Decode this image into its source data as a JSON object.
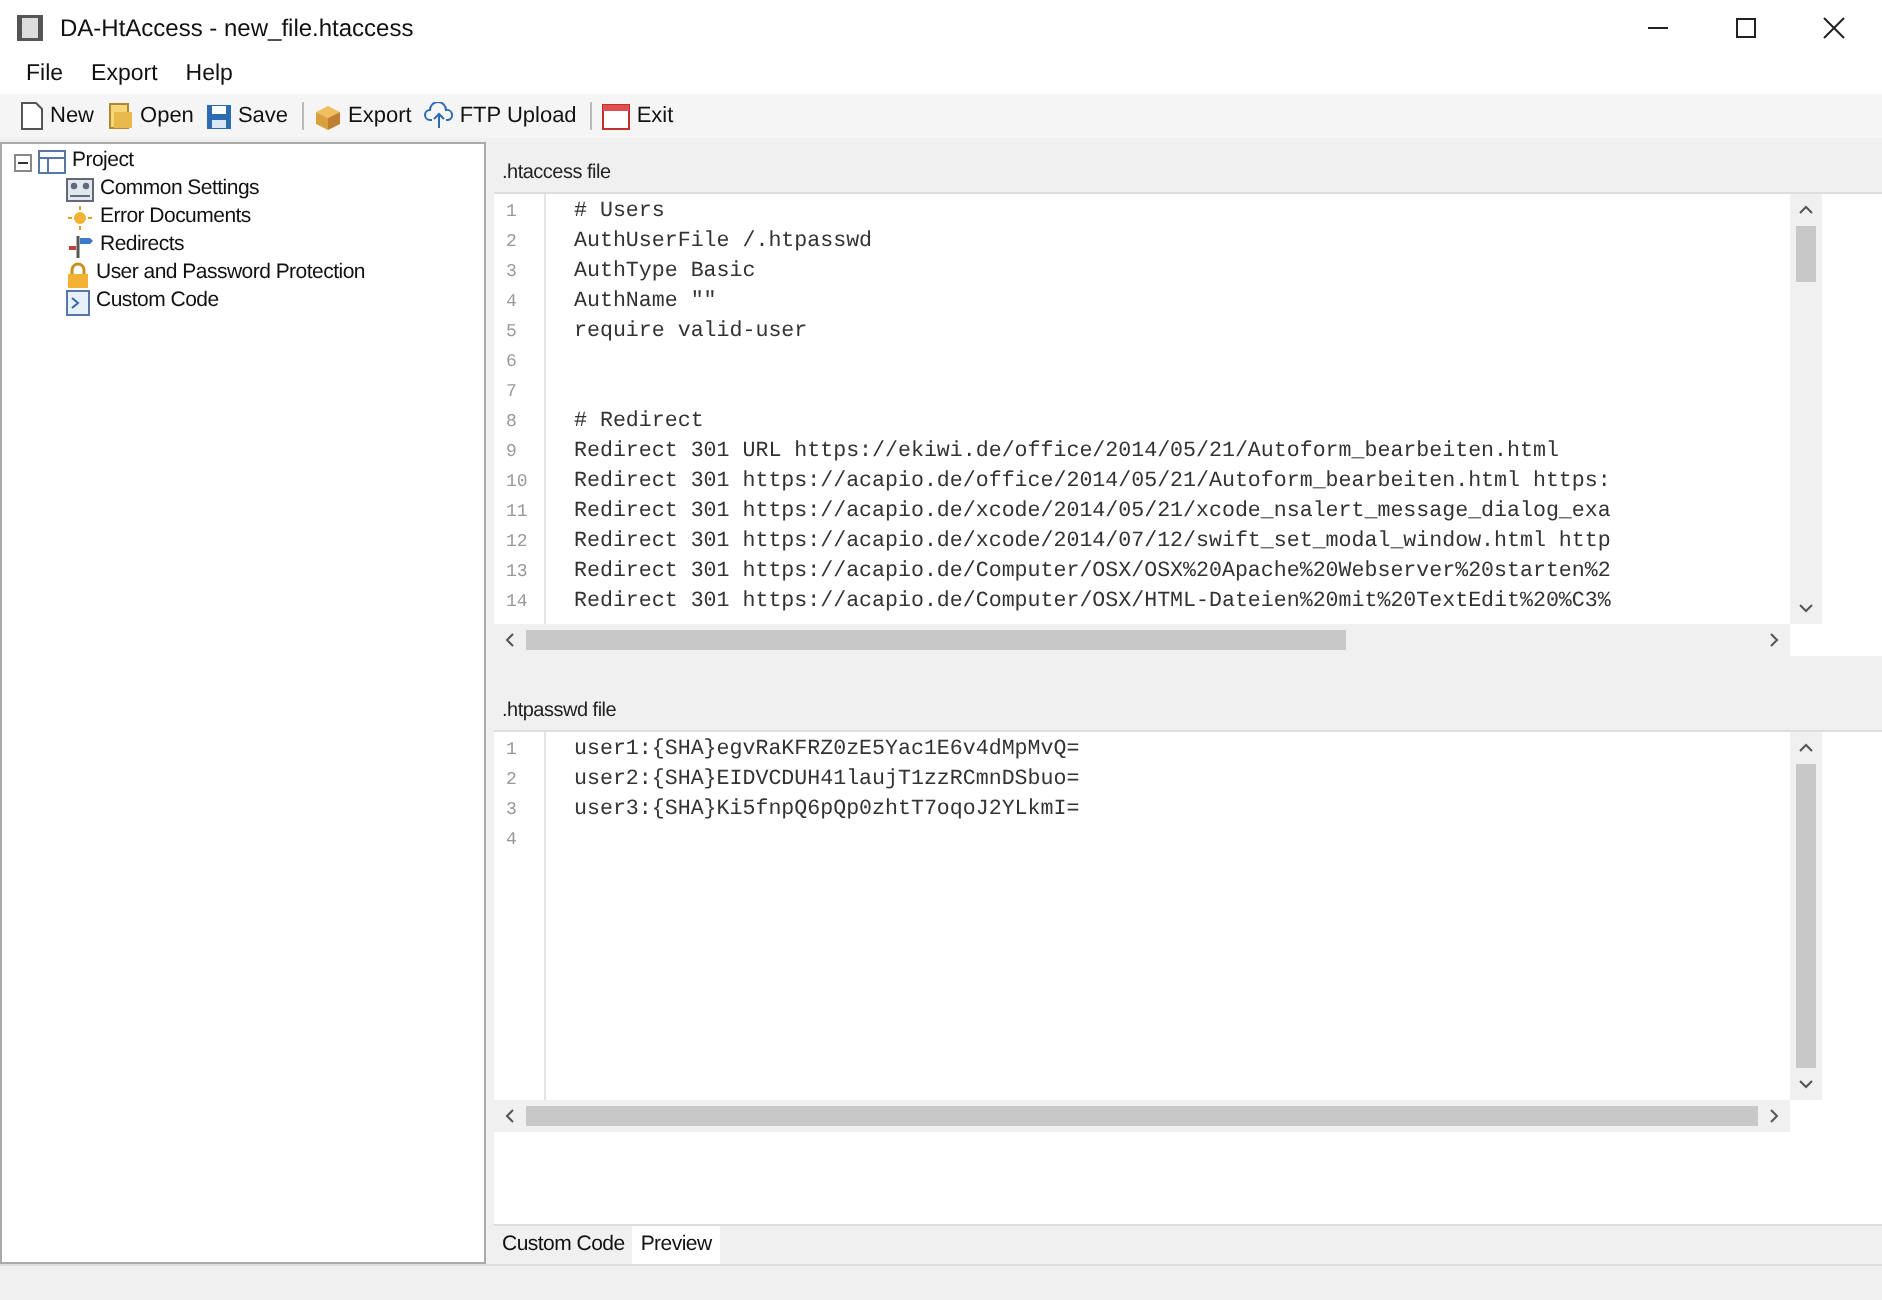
{
  "window": {
    "title": "DA-HtAccess - new_file.htaccess"
  },
  "menu": [
    "File",
    "Export",
    "Help"
  ],
  "toolbar": [
    {
      "label": "New",
      "kind": "new"
    },
    {
      "label": "Open",
      "kind": "open"
    },
    {
      "label": "Save",
      "kind": "save"
    },
    {
      "label": "Export",
      "kind": "export"
    },
    {
      "label": "FTP Upload",
      "kind": "upload"
    },
    {
      "label": "Exit",
      "kind": "exit"
    }
  ],
  "tree": [
    {
      "label": "Project",
      "kind": "project",
      "expanded": true,
      "children": [
        {
          "label": "Common Settings",
          "kind": "settings"
        },
        {
          "label": "Error Documents",
          "kind": "error"
        },
        {
          "label": "Redirects",
          "kind": "redirect"
        },
        {
          "label": "User and Password Protection",
          "kind": "lock"
        },
        {
          "label": "Custom Code",
          "kind": "code"
        }
      ]
    }
  ],
  "htaccess_editor": {
    "label": ".htaccess file",
    "lines": [
      {
        "number": "1",
        "text": "# Users"
      },
      {
        "number": "2",
        "text": "AuthUserFile /.htpasswd"
      },
      {
        "number": "3",
        "text": "AuthType Basic"
      },
      {
        "number": "4",
        "text": "AuthName \"\""
      },
      {
        "number": "5",
        "text": "require valid-user"
      },
      {
        "number": "6"
      },
      {
        "number": "7"
      },
      {
        "number": "8",
        "text": "# Redirect"
      },
      {
        "number": "9",
        "text": "Redirect 301 URL https://ekiwi.de/office/2014/05/21/Autoform_bearbeiten.html"
      },
      {
        "number": "10",
        "text": "Redirect 301 https://acapio.de/office/2014/05/21/Autoform_bearbeiten.html https:"
      },
      {
        "number": "11",
        "text": "Redirect 301 https://acapio.de/xcode/2014/05/21/xcode_nsalert_message_dialog_exa"
      },
      {
        "number": "12",
        "text": "Redirect 301 https://acapio.de/xcode/2014/07/12/swift_set_modal_window.html http"
      },
      {
        "number": "13",
        "text": "Redirect 301 https://acapio.de/Computer/OSX/OSX%20Apache%20Webserver%20starten%2"
      },
      {
        "number": "14",
        "text": "Redirect 301 https://acapio.de/Computer/OSX/HTML-Dateien%20mit%20TextEdit%20%C3%"
      }
    ]
  },
  "htpasswd_editor": {
    "label": ".htpasswd file",
    "lines": [
      {
        "number": "1",
        "text": "user1:{SHA}egvRaKFRZ0zE5Yac1E6v4dMpMvQ="
      },
      {
        "number": "2",
        "text": "user2:{SHA}EIDVCDUH41laujT1zzRCmnDSbuo="
      },
      {
        "number": "3",
        "text": "user3:{SHA}Ki5fnpQ6pQp0zhtT7oqoJ2YLkmI="
      },
      {
        "number": "4"
      }
    ]
  },
  "tabs": [
    {
      "label": "Custom Code",
      "selected": false
    },
    {
      "label": "Preview",
      "selected": true
    }
  ]
}
